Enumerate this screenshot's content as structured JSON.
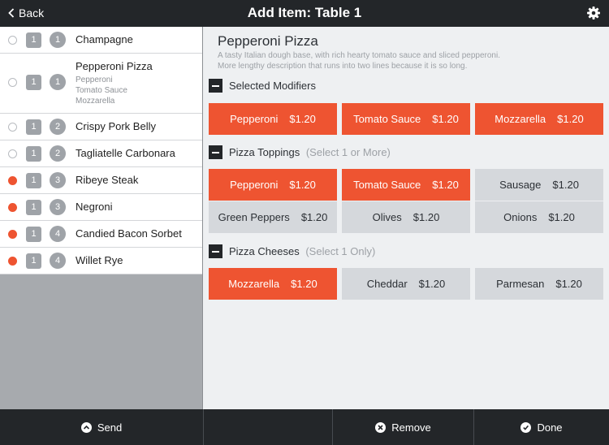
{
  "header": {
    "back_label": "Back",
    "title": "Add Item: Table 1",
    "settings_icon": "gear-icon"
  },
  "order": {
    "items": [
      {
        "qty": "1",
        "course": "1",
        "name": "Champagne",
        "status": "open",
        "modifiers": []
      },
      {
        "qty": "1",
        "course": "1",
        "name": "Pepperoni Pizza",
        "status": "open",
        "modifiers": [
          "Pepperoni",
          "Tomato Sauce",
          "Mozzarella"
        ]
      },
      {
        "qty": "1",
        "course": "2",
        "name": "Crispy Pork Belly",
        "status": "open",
        "modifiers": []
      },
      {
        "qty": "1",
        "course": "2",
        "name": "Tagliatelle Carbonara",
        "status": "open",
        "modifiers": []
      },
      {
        "qty": "1",
        "course": "3",
        "name": "Ribeye Steak",
        "status": "sent",
        "modifiers": []
      },
      {
        "qty": "1",
        "course": "3",
        "name": "Negroni",
        "status": "sent",
        "modifiers": []
      },
      {
        "qty": "1",
        "course": "4",
        "name": "Candied Bacon Sorbet",
        "status": "sent",
        "modifiers": []
      },
      {
        "qty": "1",
        "course": "4",
        "name": "Willet Rye",
        "status": "sent",
        "modifiers": []
      }
    ]
  },
  "dish": {
    "name": "Pepperoni Pizza",
    "description_line1": "A tasty Italian dough base, with rich hearty tomato sauce and sliced pepperoni.",
    "description_line2": "More lengthy description that runs into two lines because it is so long."
  },
  "sections": {
    "selected": {
      "title": "Selected Modifiers",
      "hint": "",
      "options": [
        {
          "name": "Pepperoni",
          "price": "$1.20",
          "selected": true
        },
        {
          "name": "Tomato Sauce",
          "price": "$1.20",
          "selected": true
        },
        {
          "name": "Mozzarella",
          "price": "$1.20",
          "selected": true
        }
      ]
    },
    "toppings": {
      "title": "Pizza Toppings",
      "hint": "(Select 1 or More)",
      "options": [
        {
          "name": "Pepperoni",
          "price": "$1.20",
          "selected": true
        },
        {
          "name": "Tomato Sauce",
          "price": "$1.20",
          "selected": true
        },
        {
          "name": "Sausage",
          "price": "$1.20",
          "selected": false
        },
        {
          "name": "Green Peppers",
          "price": "$1.20",
          "selected": false
        },
        {
          "name": "Olives",
          "price": "$1.20",
          "selected": false
        },
        {
          "name": "Onions",
          "price": "$1.20",
          "selected": false
        }
      ]
    },
    "cheeses": {
      "title": "Pizza Cheeses",
      "hint": "(Select 1 Only)",
      "options": [
        {
          "name": "Mozzarella",
          "price": "$1.20",
          "selected": true
        },
        {
          "name": "Cheddar",
          "price": "$1.20",
          "selected": false
        },
        {
          "name": "Parmesan",
          "price": "$1.20",
          "selected": false
        }
      ]
    }
  },
  "footer": {
    "send_label": "Send",
    "remove_label": "Remove",
    "done_label": "Done"
  },
  "colors": {
    "accent": "#ee5431",
    "dark_bar": "#232629",
    "inactive_button": "#d5d8dc"
  }
}
